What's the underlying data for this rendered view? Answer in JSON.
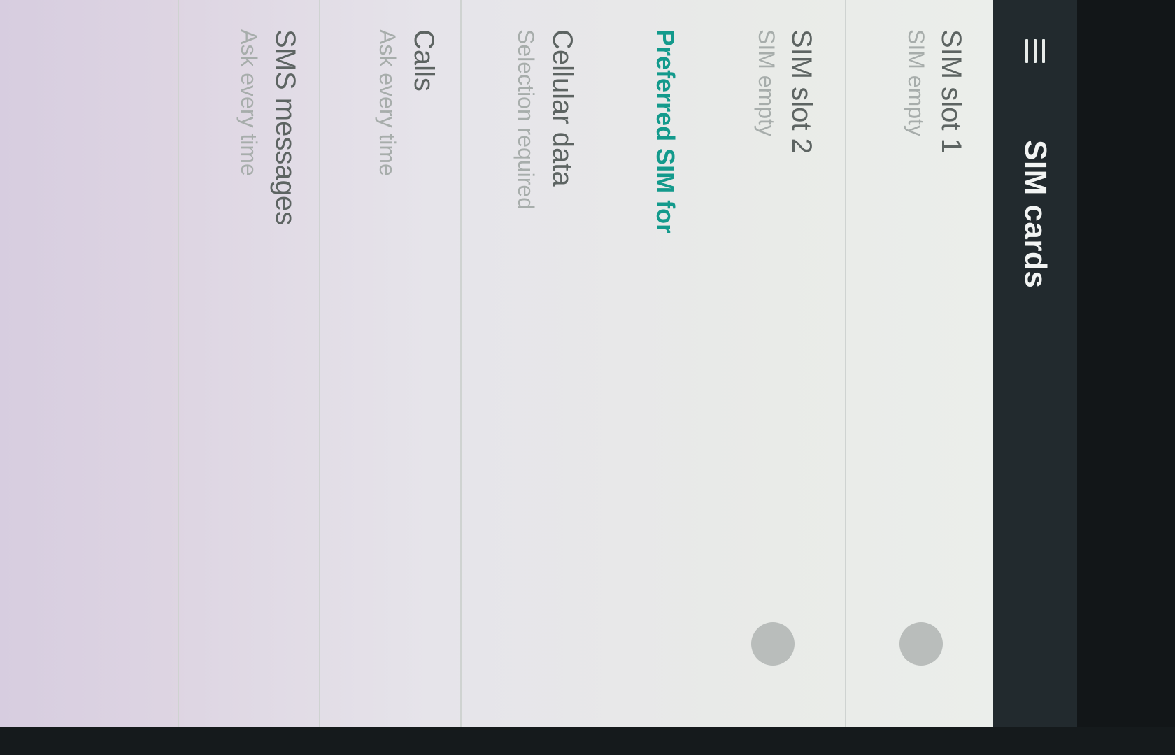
{
  "app_bar": {
    "title": "SIM cards",
    "menu_icon": "hamburger-menu-icon"
  },
  "sim_slots": [
    {
      "title": "SIM slot 1",
      "subtitle": "SIM empty",
      "toggle_on": false
    },
    {
      "title": "SIM slot 2",
      "subtitle": "SIM empty",
      "toggle_on": false
    }
  ],
  "preferred": {
    "header": "Preferred SIM for",
    "items": [
      {
        "title": "Cellular data",
        "subtitle": "Selection required"
      },
      {
        "title": "Calls",
        "subtitle": "Ask every time"
      },
      {
        "title": "SMS messages",
        "subtitle": "Ask every time"
      }
    ]
  },
  "colors": {
    "accent": "#139a8c",
    "app_bar": "#222a2e",
    "title_text": "#5d6462",
    "subtitle_text": "#a7adab"
  }
}
